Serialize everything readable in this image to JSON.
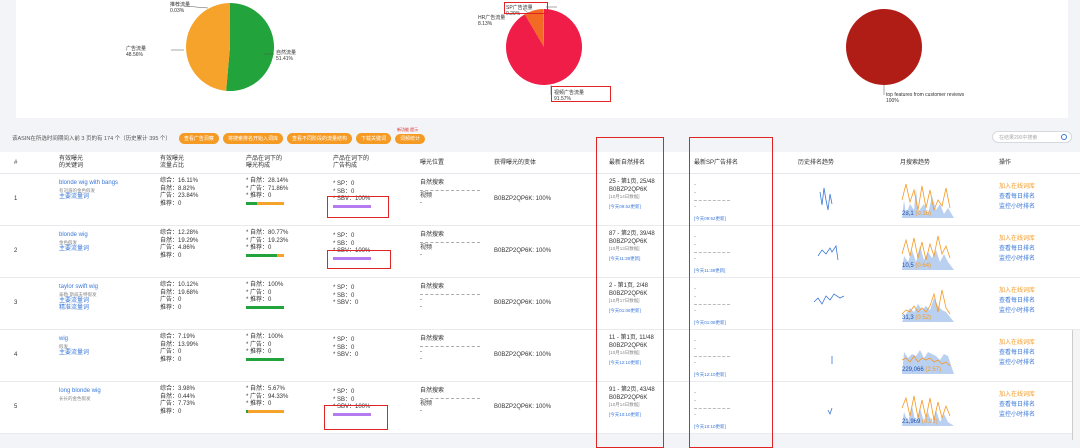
{
  "pies": [
    {
      "name": "pie-1",
      "slices": [
        {
          "label": "自然流量",
          "pct": "51.41%",
          "value": 51.41,
          "color": "#22a33b"
        },
        {
          "label": "广告流量",
          "pct": "48.56%",
          "value": 48.56,
          "color": "#f5a32a"
        },
        {
          "label": "推荐流量",
          "pct": "0.03%",
          "value": 0.03,
          "color": "#3a78d8"
        }
      ]
    },
    {
      "name": "pie-2",
      "slices": [
        {
          "label": "视频广告流量",
          "pct": "91.57%",
          "value": 91.57,
          "color": "#ef1d47"
        },
        {
          "label": "HR广告流量",
          "pct": "8.13%",
          "value": 8.13,
          "color": "#f26a23"
        },
        {
          "label": "SP广告流量",
          "pct": "0.29%",
          "value": 0.29,
          "color": "#f5a32a"
        }
      ]
    },
    {
      "name": "pie-3",
      "slices": [
        {
          "label": "top features from customer reviews",
          "pct": "100%",
          "value": 100,
          "color": "#b01c16"
        }
      ]
    }
  ],
  "info": {
    "text": "该ASIN在所选时间期间入前 3 页的有 174 个（历史累计 395 个）",
    "buttons": [
      "查看广告洞察",
      "将搜索排名开始入词库",
      "查看不同阶段的流量结构",
      "下载关键词",
      "词频统计"
    ],
    "tag": "新功能 提示"
  },
  "search": {
    "placeholder": "在结果200中搜索"
  },
  "headers": {
    "idx": "#",
    "kw": "有效曝光\n的关键词",
    "share": "有效曝光\n流量占比",
    "comp": "产品在词下的\n曝光构成",
    "adc": "产品在词下的\n广告构成",
    "pos": "曝光位置",
    "var": "获得曝光的变体",
    "rank": "最新自然排名",
    "sp": "最新SP广告排名",
    "hist": "历史排名趋势",
    "monthly": "月搜索趋势",
    "ops": "操作"
  },
  "ops": {
    "add": "加入在线词库",
    "daily": "查看每日排名",
    "hourly": "监控小时排名"
  },
  "rows": [
    {
      "idx": "1",
      "kw": "blonde wig with bangs",
      "kw_sub": "有刘海的金色假发",
      "tags": [
        "主要流量词"
      ],
      "share": [
        "综合：16.11%",
        "自然：8.82%",
        "广告：23.84%",
        "推荐：0"
      ],
      "comp": [
        "* 自然：28.14%",
        "* 广告：71.86%",
        "* 推荐：0"
      ],
      "comp_bar": [
        28.14,
        71.86
      ],
      "adc": [
        "* SP：0",
        "* SB：0",
        "* SBV：100%"
      ],
      "pos": [
        "自然搜索",
        "视频",
        "-"
      ],
      "var": "B0BZP2QP6K: 100%",
      "rank": [
        "25 - 第1页, 25/48",
        "B0BZP2QP6K",
        "[10月14日数据]",
        "[今天09:52更新]"
      ],
      "sp": [
        "-",
        "-",
        "-",
        "[今天09:52更新]"
      ],
      "monthly_val": "28,1",
      "monthly_val2": "(0.16)"
    },
    {
      "idx": "2",
      "kw": "blonde wig",
      "kw_sub": "金色假发",
      "tags": [
        "主要流量词"
      ],
      "share": [
        "综合：12.28%",
        "自然：19.29%",
        "广告：4.86%",
        "推荐：0"
      ],
      "comp": [
        "* 自然：80.77%",
        "* 广告：19.23%",
        "* 推荐：0"
      ],
      "comp_bar": [
        80.77,
        19.23
      ],
      "adc": [
        "* SP：0",
        "* SB：0",
        "* SBV：100%"
      ],
      "pos": [
        "自然搜索",
        "视频",
        "-"
      ],
      "var": "B0BZP2QP6K: 100%",
      "rank": [
        "87 - 第2页, 39/48",
        "B0BZP2QP6K",
        "[10月13日数据]",
        "[今天11:38更新]"
      ],
      "sp": [
        "-",
        "-",
        "-",
        "[今天11:38更新]"
      ],
      "monthly_val": "10,5",
      "monthly_val2": "(0.64)"
    },
    {
      "idx": "3",
      "kw": "taylor swift wig",
      "kw_sub": "泰勒·斯威夫特假发",
      "tags": [
        "主要流量词",
        "精准流量词"
      ],
      "share": [
        "综合：10.12%",
        "自然：19.68%",
        "广告：0",
        "推荐：0"
      ],
      "comp": [
        "* 自然：100%",
        "* 广告：0",
        "* 推荐：0"
      ],
      "comp_bar": [
        100,
        0
      ],
      "adc": [
        "* SP：0",
        "* SB：0",
        "* SBV：0"
      ],
      "pos": [
        "自然搜索",
        "-",
        "-"
      ],
      "var": "B0BZP2QP6K: 100%",
      "rank": [
        "2 - 第1页, 2/48",
        "B0BZP2QP6K",
        "[10月17日数据]",
        "[今天01:08更新]"
      ],
      "sp": [
        "-",
        "-",
        "-",
        "[今天01:08更新]"
      ],
      "monthly_val": "31,3",
      "monthly_val2": "(0.52)"
    },
    {
      "idx": "4",
      "kw": "wig",
      "kw_sub": "假发",
      "tags": [
        "主要流量词"
      ],
      "share": [
        "综合：7.19%",
        "自然：13.99%",
        "广告：0",
        "推荐：0"
      ],
      "comp": [
        "* 自然：100%",
        "* 广告：0",
        "* 推荐：0"
      ],
      "comp_bar": [
        100,
        0
      ],
      "adc": [
        "* SP：0",
        "* SB：0",
        "* SBV：0"
      ],
      "pos": [
        "自然搜索",
        "-",
        "-"
      ],
      "var": "B0BZP2QP6K: 100%",
      "rank": [
        "11 - 第1页, 11/48",
        "B0BZP2QP6K",
        "[10月14日数据]",
        "[今天12:10更新]"
      ],
      "sp": [
        "-",
        "-",
        "-",
        "[今天12:10更新]"
      ],
      "monthly_val": "229,066",
      "monthly_val2": "(2.57)"
    },
    {
      "idx": "5",
      "kw": "long blonde wig",
      "kw_sub": "长长的金色假发",
      "tags": [],
      "share": [
        "综合：3.98%",
        "自然：0.44%",
        "广告：7.73%",
        "推荐：0"
      ],
      "comp": [
        "* 自然：5.67%",
        "* 广告：94.33%",
        "* 推荐：0"
      ],
      "comp_bar": [
        5.67,
        94.33
      ],
      "adc": [
        "* SP：0",
        "* SB：0",
        "* SBV：100%"
      ],
      "pos": [
        "自然搜索",
        "视频",
        "-"
      ],
      "var": "B0BZP2QP6K: 100%",
      "rank": [
        "91 - 第2页, 43/48",
        "B0BZP2QP6K",
        "[10月14日数据]",
        "[今天10:10更新]"
      ],
      "sp": [
        "-",
        "-",
        "-",
        "[今天10:10更新]"
      ],
      "monthly_val": "21,969",
      "monthly_val2": "(0.92)"
    }
  ]
}
